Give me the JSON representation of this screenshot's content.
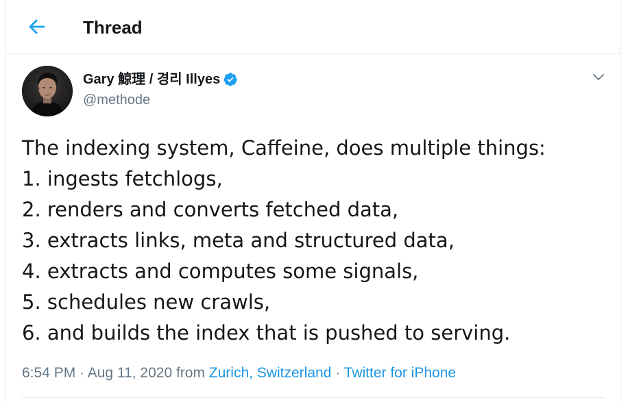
{
  "header": {
    "title": "Thread",
    "back_icon": "arrow-left-icon"
  },
  "colors": {
    "accent": "#1da1f2",
    "link": "#1b95e0",
    "text": "#14171a",
    "secondary": "#657786",
    "divider": "#e6ecf0"
  },
  "tweet": {
    "author": {
      "display_name": "Gary 鯨理 / 경리 Illyes",
      "handle": "@methode",
      "verified_icon": "verified-badge-icon"
    },
    "menu_icon": "chevron-down-icon",
    "text_lines": [
      "The indexing system, Caffeine, does multiple things:",
      "1. ingests fetchlogs,",
      "2. renders and converts fetched data,",
      "3. extracts links, meta and structured data,",
      "4. extracts and computes some signals,",
      "5. schedules new crawls,",
      "6. and builds the index that is pushed to serving."
    ],
    "meta": {
      "time": "6:54 PM",
      "separator": " · ",
      "date": "Aug 11, 2020",
      "from_label": " from ",
      "location": "Zurich, Switzerland",
      "source": "Twitter for iPhone"
    }
  }
}
